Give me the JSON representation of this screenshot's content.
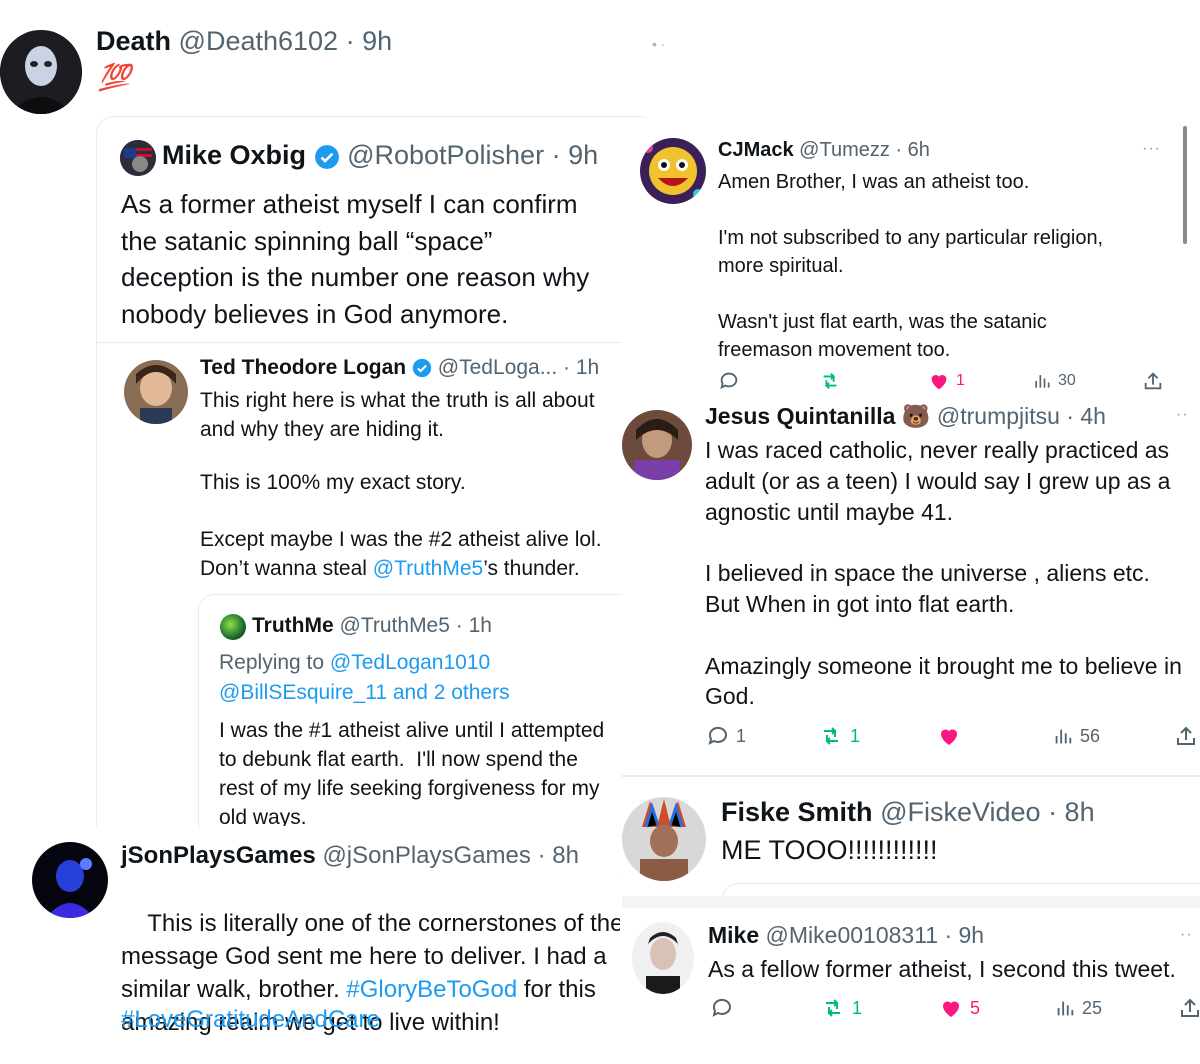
{
  "death": {
    "name": "Death",
    "handle": "@Death6102",
    "time": "· 9h",
    "emoji": "💯"
  },
  "oxbig": {
    "name": "Mike Oxbig",
    "handle": "@RobotPolisher",
    "time": "· 9h",
    "text": "As a former atheist myself I can confirm\nthe satanic spinning ball “space”\ndeception is the number one reason why\nnobody believes in God anymore."
  },
  "ted": {
    "name": "Ted Theodore Logan",
    "handle": "@TedLoga...",
    "time": "· 1h",
    "line1": "This right here is what the truth is all about\nand why they are hiding it.",
    "line2": "This is 100% my exact story.",
    "line3": "Except maybe I was the #2 atheist alive lol.",
    "line4_pre": "Don’t wanna steal ",
    "line4_link": "@TruthMe5",
    "line4_post": "’s thunder."
  },
  "truthme": {
    "name": "TruthMe",
    "handle": "@TruthMe5",
    "time": "· 1h",
    "replying_pre": "Replying to ",
    "replying_link1": "@TedLogan1010",
    "replying_link2": "@BillSEsquire_11 and 2 others",
    "text": "I was the #1 atheist alive until I attempted\nto debunk flat earth.  I'll now spend the\nrest of my life seeking forgiveness for my\nold ways."
  },
  "json": {
    "name": "jSonPlaysGames",
    "handle": "@jSonPlaysGames",
    "time": "· 8h",
    "text_a": "This is literally one of the cornerstones of the\nmessage God sent me here to deliver. I had a\nsimilar walk, brother. ",
    "hashtag1": "#GloryBeToGod",
    "text_b": " for this\namazing realm we get to live within!",
    "hashtag2": "#LoveGratitudeAndCare"
  },
  "cjmack": {
    "name": "CJMack",
    "handle": "@Tumezz",
    "time": "· 6h",
    "text": "Amen Brother, I was an atheist too.\n\nI'm not subscribed to any particular religion,\nmore spiritual.\n\nWasn't just flat earth, was the satanic\nfreemason movement too.",
    "likes": "1",
    "views": "30"
  },
  "jesus": {
    "name": "Jesus Quintanilla",
    "emoji": "🐻",
    "handle": "@trumpjitsu",
    "time": "· 4h",
    "text": "I was raced catholic, never really practiced as\nadult (or as a teen) I would say I grew up as a\nagnostic until maybe 41.\n\nI believed in space the universe , aliens etc.\nBut When in got into flat earth.\n\nAmazingly someone it brought me to believe in\nGod.",
    "replies": "1",
    "retweets": "1",
    "views": "56"
  },
  "fiske": {
    "name": "Fiske Smith",
    "handle": "@FiskeVideo",
    "time": "· 8h",
    "text": "ME TOOO!!!!!!!!!!!!"
  },
  "mike": {
    "name": "Mike",
    "handle": "@Mike00108311",
    "time": "· 9h",
    "text": "As a fellow former atheist, I second this tweet.",
    "retweets": "1",
    "likes": "5",
    "views": "25"
  },
  "colors": {
    "verified": "#1d9bf0",
    "like": "#f91880",
    "retweet": "#00ba7c",
    "link": "#1d9bf0"
  },
  "icons": [
    "reply-icon",
    "retweet-icon",
    "heart-icon",
    "views-icon",
    "share-icon",
    "verified-icon",
    "more-icon"
  ]
}
